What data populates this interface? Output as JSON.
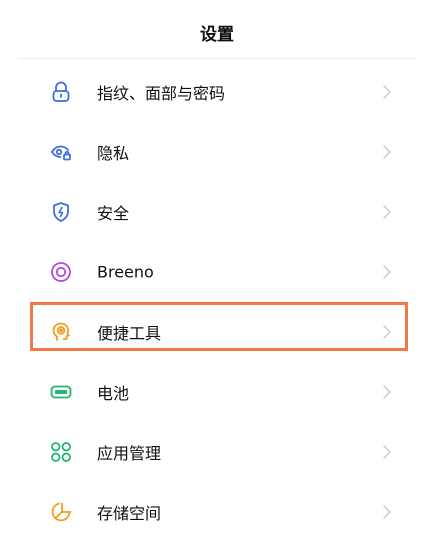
{
  "header": {
    "title": "设置"
  },
  "settings": {
    "items": [
      {
        "label": "指纹、面部与密码",
        "icon": "lock-icon",
        "color": "#3d6fe0"
      },
      {
        "label": "隐私",
        "icon": "eye-lock-icon",
        "color": "#3d6fe0"
      },
      {
        "label": "安全",
        "icon": "shield-icon",
        "color": "#3d6fe0"
      },
      {
        "label": "Breeno",
        "icon": "breeno-icon",
        "color": "#b04bdb"
      },
      {
        "label": "便捷工具",
        "icon": "head-gear-icon",
        "color": "#f0a020"
      },
      {
        "label": "电池",
        "icon": "battery-icon",
        "color": "#22b573"
      },
      {
        "label": "应用管理",
        "icon": "apps-grid-icon",
        "color": "#22b573"
      },
      {
        "label": "存储空间",
        "icon": "storage-pie-icon",
        "color": "#f0a020"
      }
    ]
  },
  "highlight": {
    "item_label": "便捷工具",
    "color": "#f07a45"
  }
}
